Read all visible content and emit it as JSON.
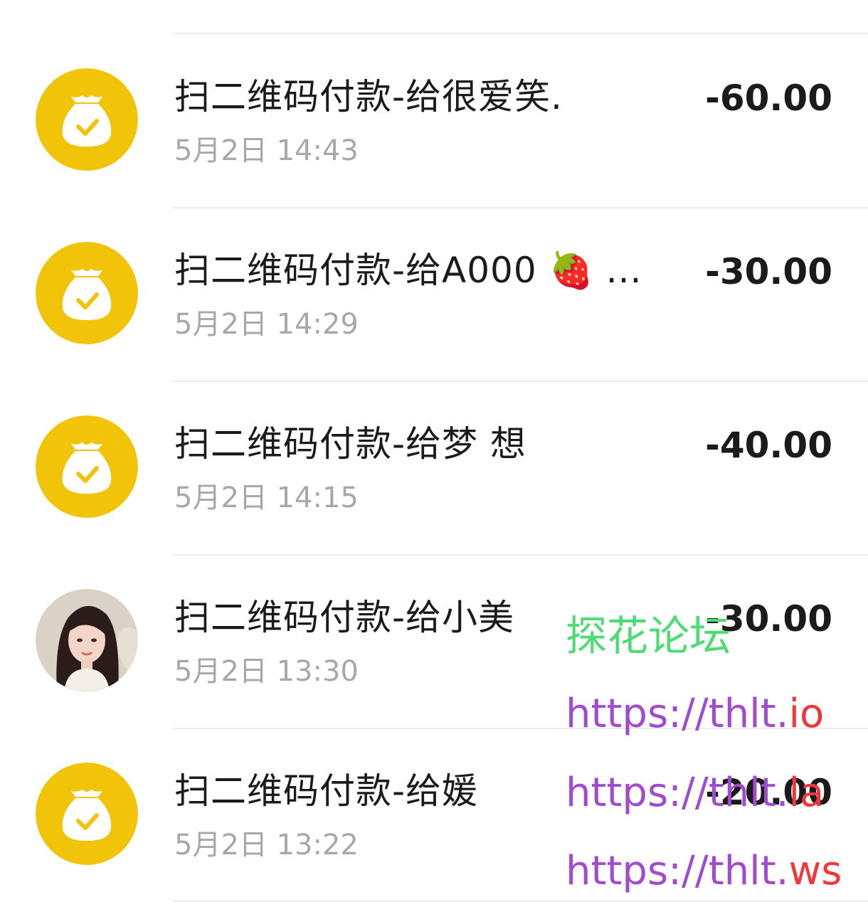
{
  "transactions": [
    {
      "title": "扫二维码付款-给很爱笑.",
      "time": "5月2日 14:43",
      "amount": "-60.00",
      "avatar_icon": "money-bag-check-icon"
    },
    {
      "title": "扫二维码付款-给A000 🍓 ...",
      "time": "5月2日 14:29",
      "amount": "-30.00",
      "avatar_icon": "money-bag-check-icon"
    },
    {
      "title": "扫二维码付款-给梦 想",
      "time": "5月2日 14:15",
      "amount": "-40.00",
      "avatar_icon": "money-bag-check-icon"
    },
    {
      "title": "扫二维码付款-给小美",
      "time": "5月2日 13:30",
      "amount": "-30.00",
      "avatar_icon": "user-photo-avatar"
    },
    {
      "title": "扫二维码付款-给媛",
      "time": "5月2日 13:22",
      "amount": "-20.00",
      "avatar_icon": "money-bag-check-icon"
    }
  ],
  "watermark": {
    "name": "探花论坛",
    "urls": [
      {
        "base": "https://thlt.",
        "tld": "io"
      },
      {
        "base": "https://thlt.",
        "tld": "la"
      },
      {
        "base": "https://thlt.",
        "tld": "ws"
      }
    ]
  },
  "colors": {
    "icon_bg": "#f1c40a",
    "title": "#1b1b1b",
    "time": "#a8a8a8",
    "watermark_cn": "#4ddb73",
    "watermark_url": "#a24bd1",
    "watermark_tld": "#f0373b"
  }
}
